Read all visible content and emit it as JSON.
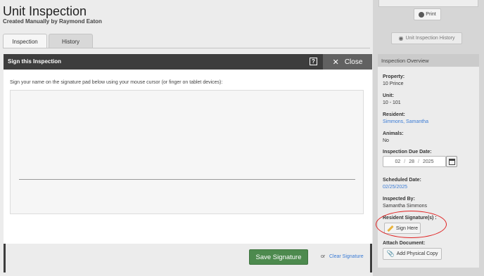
{
  "header": {
    "title": "Unit Inspection",
    "subtitle": "Created Manually by Raymond Eaton"
  },
  "tabs": [
    {
      "label": "Inspection",
      "active": true
    },
    {
      "label": "History",
      "active": false
    }
  ],
  "modal": {
    "title": "Sign this Inspection",
    "help_label": "?",
    "close_label": "Close",
    "instructions": "Sign your name on the signature pad below using your mouse cursor (or finger on tablet devices):",
    "save_label": "Save Signature",
    "or_text": "or",
    "clear_label": "Clear Signature"
  },
  "sidebar": {
    "print_label": "Print",
    "history_label": "Unit Inspection History",
    "overview_title": "Inspection Overview",
    "property_label": "Property:",
    "property_value": "10 Prince",
    "unit_label": "Unit:",
    "unit_value": "10 - 101",
    "resident_label": "Resident:",
    "resident_value": "Simmons, Samantha",
    "animals_label": "Animals:",
    "animals_value": "No",
    "due_date_label": "Inspection Due Date:",
    "due_date": {
      "month": "02",
      "day": "28",
      "year": "2025",
      "separator": "/"
    },
    "scheduled_label": "Scheduled Date:",
    "scheduled_value": "02/25/2025",
    "inspected_by_label": "Inspected By:",
    "inspected_by_value": "Samantha Simmons",
    "resident_sig_label": "Resident Signature(s) :",
    "sign_here_label": "Sign Here",
    "attach_label": "Attach Document:",
    "add_copy_label": "Add Physical Copy"
  },
  "colors": {
    "modal_header": "#3d3d3d",
    "save_button": "#4d8a4e",
    "link": "#3a7bd5",
    "highlight_ellipse": "#e02020",
    "pencil": "#e9b43d"
  }
}
